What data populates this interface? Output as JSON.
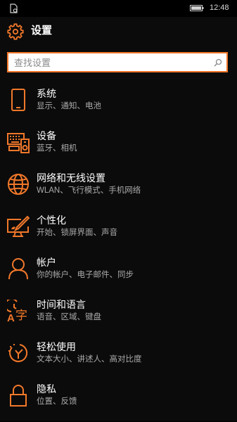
{
  "status_bar": {
    "time": "12:48",
    "left_icon": "notification-icon",
    "right_icon": "battery-icon"
  },
  "header": {
    "title": "设置",
    "icon": "gear-icon"
  },
  "search": {
    "placeholder": "查找设置",
    "value": "",
    "icon": "search-icon"
  },
  "accent_color": "#f2782a",
  "settings": [
    {
      "icon": "phone-icon",
      "title": "系统",
      "subtitle": "显示、通知、电池"
    },
    {
      "icon": "devices-icon",
      "title": "设备",
      "subtitle": "蓝牙、相机"
    },
    {
      "icon": "globe-icon",
      "title": "网络和无线设置",
      "subtitle": "WLAN、飞行模式、手机网络"
    },
    {
      "icon": "personalization-icon",
      "title": "个性化",
      "subtitle": "开始、锁屏界面、声音"
    },
    {
      "icon": "account-icon",
      "title": "帐户",
      "subtitle": "你的帐户、电子邮件、同步"
    },
    {
      "icon": "time-language-icon",
      "title": "时间和语言",
      "subtitle": "语音、区域、键盘"
    },
    {
      "icon": "ease-of-access-icon",
      "title": "轻松使用",
      "subtitle": "文本大小、讲述人、高对比度"
    },
    {
      "icon": "privacy-icon",
      "title": "隐私",
      "subtitle": "位置、反馈"
    }
  ]
}
